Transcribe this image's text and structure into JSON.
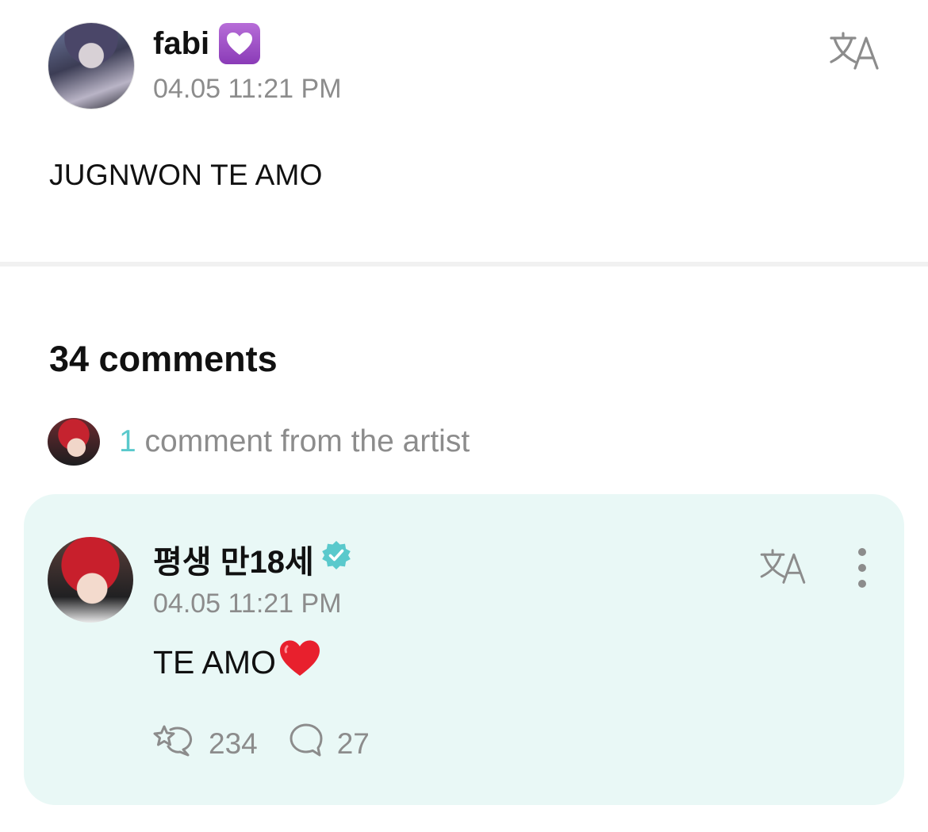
{
  "post": {
    "author": "fabi",
    "timestamp": "04.05 11:21 PM",
    "body": "JUGNWON TE AMO",
    "badge_icon": "purple-heart-icon"
  },
  "comments": {
    "count_label": "34 comments",
    "artist_summary": {
      "count": "1",
      "label": " comment from the artist"
    }
  },
  "artist_comment": {
    "author": "평생 만18세",
    "timestamp": "04.05 11:21 PM",
    "text": "TE AMO",
    "text_emoji_icon": "red-heart-icon",
    "likes": "234",
    "replies": "27",
    "verified_icon": "verified-badge-icon"
  },
  "colors": {
    "accent": "#5ac9cc",
    "card_background": "#e9f8f6",
    "muted_text": "#8c8c8c"
  }
}
